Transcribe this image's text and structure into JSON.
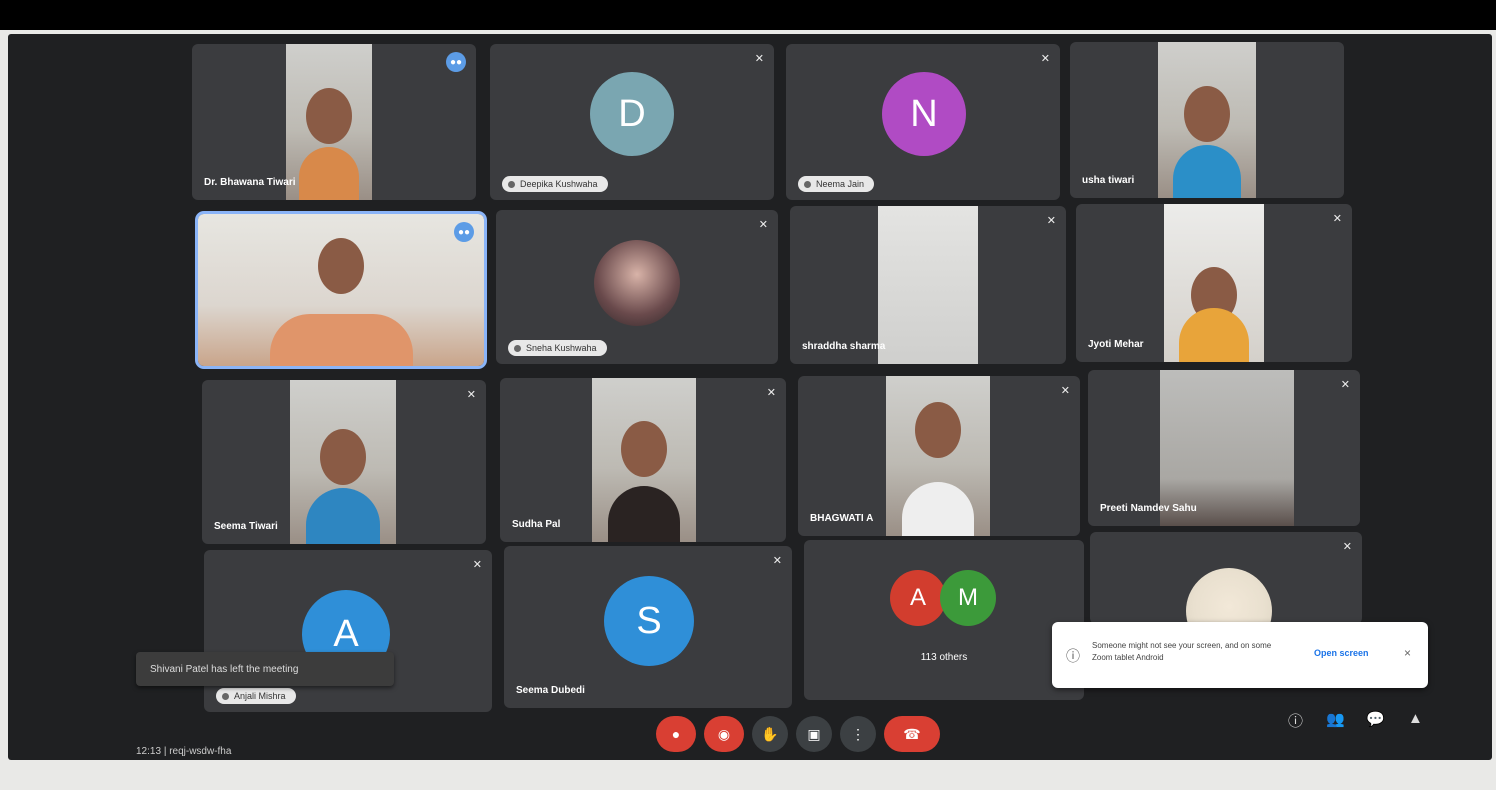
{
  "tiles": {
    "r1c1": {
      "name": "Dr. Bhawana Tiwari"
    },
    "r1c2": {
      "initial": "D",
      "name": "Deepika Kushwaha",
      "avatar_color": "#7aa6b1"
    },
    "r1c3": {
      "initial": "N",
      "name": "Neema Jain",
      "avatar_color": "#b04bc4"
    },
    "r1c4": {
      "name": "usha tiwari"
    },
    "r2c1": {
      "name": ""
    },
    "r2c2": {
      "name": "Sneha Kushwaha"
    },
    "r2c3": {
      "name": "shraddha sharma"
    },
    "r2c4": {
      "name": "Jyoti Mehar"
    },
    "r3c1": {
      "name": "Seema Tiwari"
    },
    "r3c2": {
      "name": "Sudha Pal"
    },
    "r3c3": {
      "name": "BHAGWATI A"
    },
    "r3c4": {
      "name": "Preeti Namdev Sahu"
    },
    "r4c1": {
      "initial": "A",
      "name": "Anjali Mishra",
      "avatar_color": "#2f8fd8"
    },
    "r4c2": {
      "initial": "S",
      "name": "Seema Dubedi",
      "avatar_color": "#2f8fd8"
    },
    "r4c3": {
      "initials": [
        "A",
        "M"
      ],
      "colors": [
        "#d23d2e",
        "#3c9a3a"
      ],
      "others_label": "113 others"
    },
    "r4c4": {
      "name": ""
    }
  },
  "toast": {
    "text": "Shivani Patel has left the meeting"
  },
  "notice": {
    "text": "Someone might not see your screen, and on some Zoom tablet Android",
    "button": "Open screen",
    "close": "×"
  },
  "bottombar": {
    "time": "12:13",
    "meeting": "| reqj-wsdw-fha"
  },
  "controls": {
    "mic_icon": "mic-off-icon",
    "cam_icon": "camera-off-icon",
    "hand_icon": "raise-hand-icon",
    "present_icon": "present-icon",
    "more_icon": "more-icon",
    "leave_icon": "hang-up-icon"
  },
  "right_controls": [
    "info-icon",
    "people-icon",
    "chat-icon",
    "activities-icon"
  ]
}
